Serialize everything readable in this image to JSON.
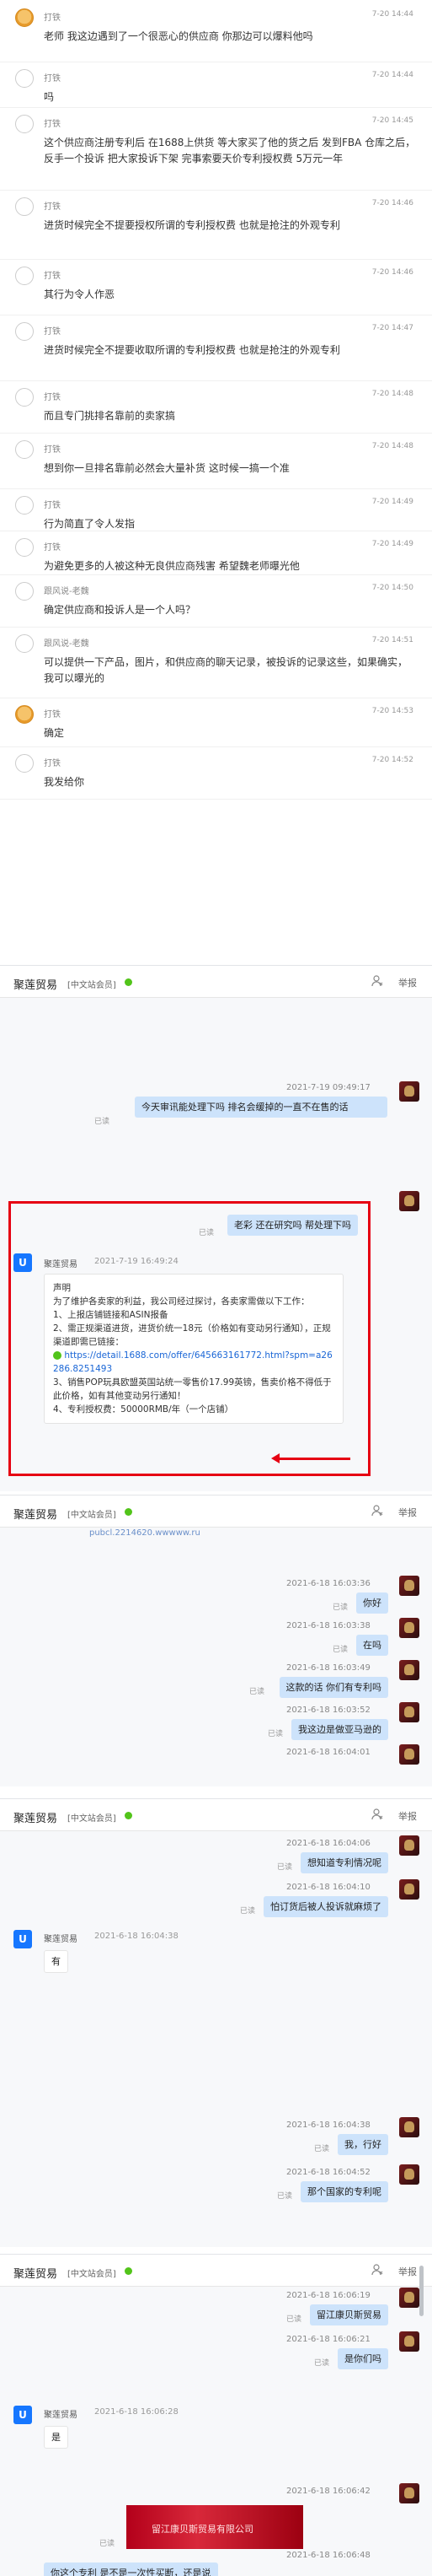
{
  "section1": {
    "messages": [
      {
        "name": "打铁",
        "time": "7-20 14:44",
        "avatar": "monkey",
        "text": "老师  我这边遇到了一个很恶心的供应商 你那边可以爆料他吗"
      },
      {
        "name": "打铁",
        "time": "7-20 14:44",
        "avatar": "gray",
        "text": "吗"
      },
      {
        "name": "打铁",
        "time": "7-20 14:45",
        "avatar": "gray",
        "text": "这个供应商注册专利后 在1688上供货  等大家买了他的货之后 发到FBA 仓库之后，  反手一个投诉 把大家投诉下架  完事索要天价专利授权费 5万元一年"
      },
      {
        "name": "打铁",
        "time": "7-20 14:46",
        "avatar": "gray",
        "text": "进货时候完全不提要授权所谓的专利授权费 也就是抢注的外观专利"
      },
      {
        "name": "打铁",
        "time": "7-20 14:46",
        "avatar": "gray",
        "text": "其行为令人作恶"
      },
      {
        "name": "打铁",
        "time": "7-20 14:47",
        "avatar": "gray",
        "text": "进货时候完全不提要收取所谓的专利授权费 也就是抢注的外观专利"
      },
      {
        "name": "打铁",
        "time": "7-20 14:48",
        "avatar": "gray",
        "text": "而且专门挑排名靠前的卖家搞"
      },
      {
        "name": "打铁",
        "time": "7-20 14:48",
        "avatar": "gray",
        "text": "想到你一旦排名靠前必然会大量补货 这时候一搞一个准"
      },
      {
        "name": "打铁",
        "time": "7-20 14:49",
        "avatar": "gray",
        "text": "行为简直了令人发指"
      },
      {
        "name": "打铁",
        "time": "7-20 14:49",
        "avatar": "gray",
        "text": "为避免更多的人被这种无良供应商残害 希望魏老师曝光他"
      },
      {
        "name": "跟风说-老魏",
        "time": "7-20 14:50",
        "avatar": "gray",
        "text": "确定供应商和投诉人是一个人吗？"
      },
      {
        "name": "跟风说-老魏",
        "time": "7-20 14:51",
        "avatar": "gray",
        "text": "可以提供一下产品，图片，和供应商的聊天记录，被投诉的记录这些，如果确实，我可以曝光的"
      },
      {
        "name": "打铁",
        "time": "7-20 14:53",
        "avatar": "monkey",
        "text": "确定"
      },
      {
        "name": "打铁",
        "time": "7-20 14:52",
        "avatar": "gray",
        "text": "我发给你"
      }
    ]
  },
  "panel_header": {
    "name": "聚莲贸易",
    "badge": "[中文站会员]",
    "report": "举报",
    "user_icon": "user-icon",
    "online_color": "#52c41a"
  },
  "panel2": {
    "msg1_time": "2021-7-19 09:49:17",
    "msg1_text": "今天审讯能处理下吗  排名会缓掉的一直不在售的话",
    "read": "已读",
    "msg2_text": "老彩 还在研究吗  帮处理下吗",
    "decl_name": "聚莲贸易",
    "decl_time": "2021-7-19 16:49:24",
    "decl_title": "声明",
    "decl_intro": "为了维护各卖家的利益，我公司经过探讨，各卖家需做以下工作：",
    "decl_item1": "1、上报店铺链接和ASIN报备",
    "decl_item2": "2、需正规渠道进货，进货价统一18元（价格如有变动另行通知），正规渠道即需已链接：",
    "decl_link": "https://detail.1688.com/offer/645663161772.html?spm=a26286.8251493",
    "decl_item3": "3、销售POP玩具欧盟英国站统一零售价17.99英镑，售卖价格不得低于此价格，如有其他变动另行通知！",
    "decl_item4": "4、专利授权费：50000RMB/年（一个店铺）"
  },
  "panel3": {
    "top_link": "pubcl.2214620.wwwww.ru",
    "rows": [
      {
        "time": "2021-6-18 16:03:36",
        "text": "你好",
        "read": "已读"
      },
      {
        "time": "2021-6-18 16:03:38",
        "text": "在吗",
        "read": "已读"
      },
      {
        "time": "2021-6-18 16:03:49",
        "text": "这款的话 你们有专利吗",
        "read": "已读"
      },
      {
        "time": "2021-6-18 16:03:52",
        "text": "我这边是做亚马逊的",
        "read": "已读"
      },
      {
        "time": "2021-6-18 16:04:01",
        "text": "",
        "read": ""
      }
    ]
  },
  "panel4": {
    "rows_right": [
      {
        "time": "2021-6-18 16:04:06",
        "text": "想知道专利情况呢",
        "read": "已读"
      },
      {
        "time": "2021-6-18 16:04:10",
        "text": "怕订货后被人投诉就麻烦了",
        "read": "已读"
      }
    ],
    "left_name": "聚莲贸易",
    "left_time": "2021-6-18 16:04:38",
    "left_text": "有",
    "rows_right2": [
      {
        "time": "2021-6-18 16:04:38",
        "text": "我，行好",
        "read": "已读"
      },
      {
        "time": "2021-6-18 16:04:52",
        "text": "那个国家的专利呢",
        "read": "已读"
      }
    ]
  },
  "panel5": {
    "rows_right": [
      {
        "time": "2021-6-18 16:06:19",
        "text": "留江康贝斯贸易",
        "read": "已读"
      },
      {
        "time": "2021-6-18 16:06:21",
        "text": "是你们吗",
        "read": "已读"
      }
    ],
    "left_name": "聚莲贸易",
    "left_time": "2021-6-18 16:06:28",
    "left_text": "是",
    "img_time": "2021-6-18 16:06:42",
    "img_text": "留江康贝斯贸易有限公司",
    "bottom_time": "2021-6-18 16:06:48",
    "bottom_text": "你这个专利 是不是一次性买断，还是说"
  }
}
